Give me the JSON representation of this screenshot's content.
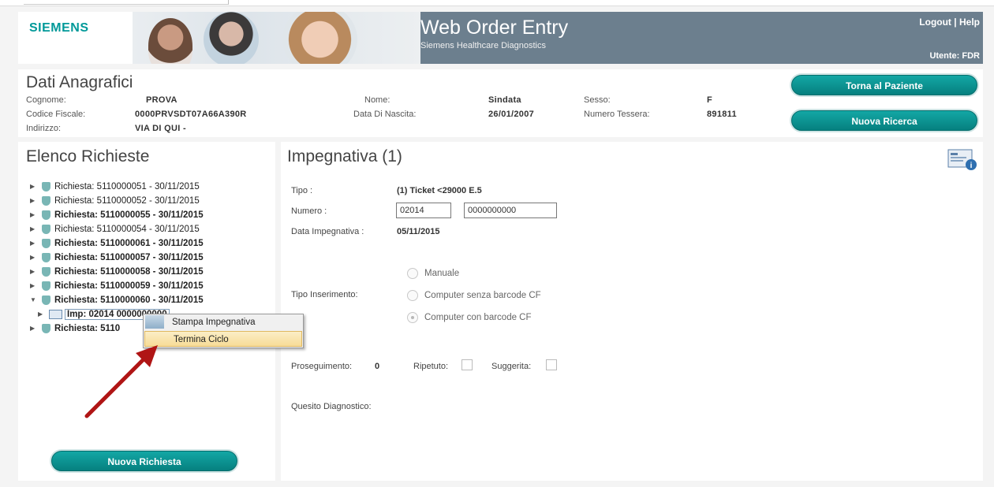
{
  "header": {
    "logo": "SIEMENS",
    "title": "Web Order Entry",
    "subtitle": "Siemens Healthcare Diagnostics",
    "logout": "Logout",
    "sep": "|",
    "help": "Help",
    "user": "Utente: FDR"
  },
  "patient": {
    "heading": "Dati Anagrafici",
    "cognome_label": "Cognome:",
    "cognome": "PROVA",
    "cf_label": "Codice Fiscale:",
    "cf": "0000PRVSDT07A66A390R",
    "indirizzo_label": "Indirizzo:",
    "indirizzo": "VIA DI QUI -",
    "nome_label": "Nome:",
    "nome": "Sindata",
    "nascita_label": "Data Di Nascita:",
    "nascita": "26/01/2007",
    "sesso_label": "Sesso:",
    "sesso": "F",
    "tessera_label": "Numero Tessera:",
    "tessera": "891811",
    "btn_torna": "Torna al Paziente",
    "btn_ricerca": "Nuova Ricerca"
  },
  "left": {
    "heading": "Elenco Richieste",
    "requests": [
      {
        "label": "Richiesta: 5110000051 - 30/11/2015",
        "bold": false
      },
      {
        "label": "Richiesta: 5110000052 - 30/11/2015",
        "bold": false
      },
      {
        "label": "Richiesta: 5110000055 - 30/11/2015",
        "bold": true
      },
      {
        "label": "Richiesta: 5110000054 - 30/11/2015",
        "bold": false
      },
      {
        "label": "Richiesta: 5110000061 - 30/11/2015",
        "bold": true
      },
      {
        "label": "Richiesta: 5110000057 - 30/11/2015",
        "bold": true
      },
      {
        "label": "Richiesta: 5110000058 - 30/11/2015",
        "bold": true
      },
      {
        "label": "Richiesta: 5110000059 - 30/11/2015",
        "bold": true
      },
      {
        "label": "Richiesta: 5110000060 - 30/11/2015",
        "bold": true
      }
    ],
    "sub_item": "Imp: 02014 0000000000",
    "last_request": "Richiesta: 5110",
    "context_menu": [
      "Stampa Impegnativa",
      "Termina Ciclo"
    ],
    "btn_nuova": "Nuova Richiesta"
  },
  "right": {
    "heading": "Impegnativa (1)",
    "tipo_label": "Tipo :",
    "tipo": "(1) Ticket <29000 E.5",
    "numero_label": "Numero :",
    "numero1": "02014",
    "numero2": "0000000000",
    "data_label": "Data Impegnativa :",
    "data": "05/11/2015",
    "inserimento_label": "Tipo Inserimento:",
    "radio_manuale": "Manuale",
    "radio_senza": "Computer senza barcode CF",
    "radio_con": "Computer con barcode CF",
    "proseguimento_label": "Proseguimento:",
    "proseguimento": "0",
    "ripetuto_label": "Ripetuto:",
    "suggerita_label": "Suggerita:",
    "quesito_label": "Quesito Diagnostico:"
  },
  "colors": {
    "accent": "#06807f",
    "header_bg": "#6c7f8e",
    "arrow": "#b01515"
  }
}
